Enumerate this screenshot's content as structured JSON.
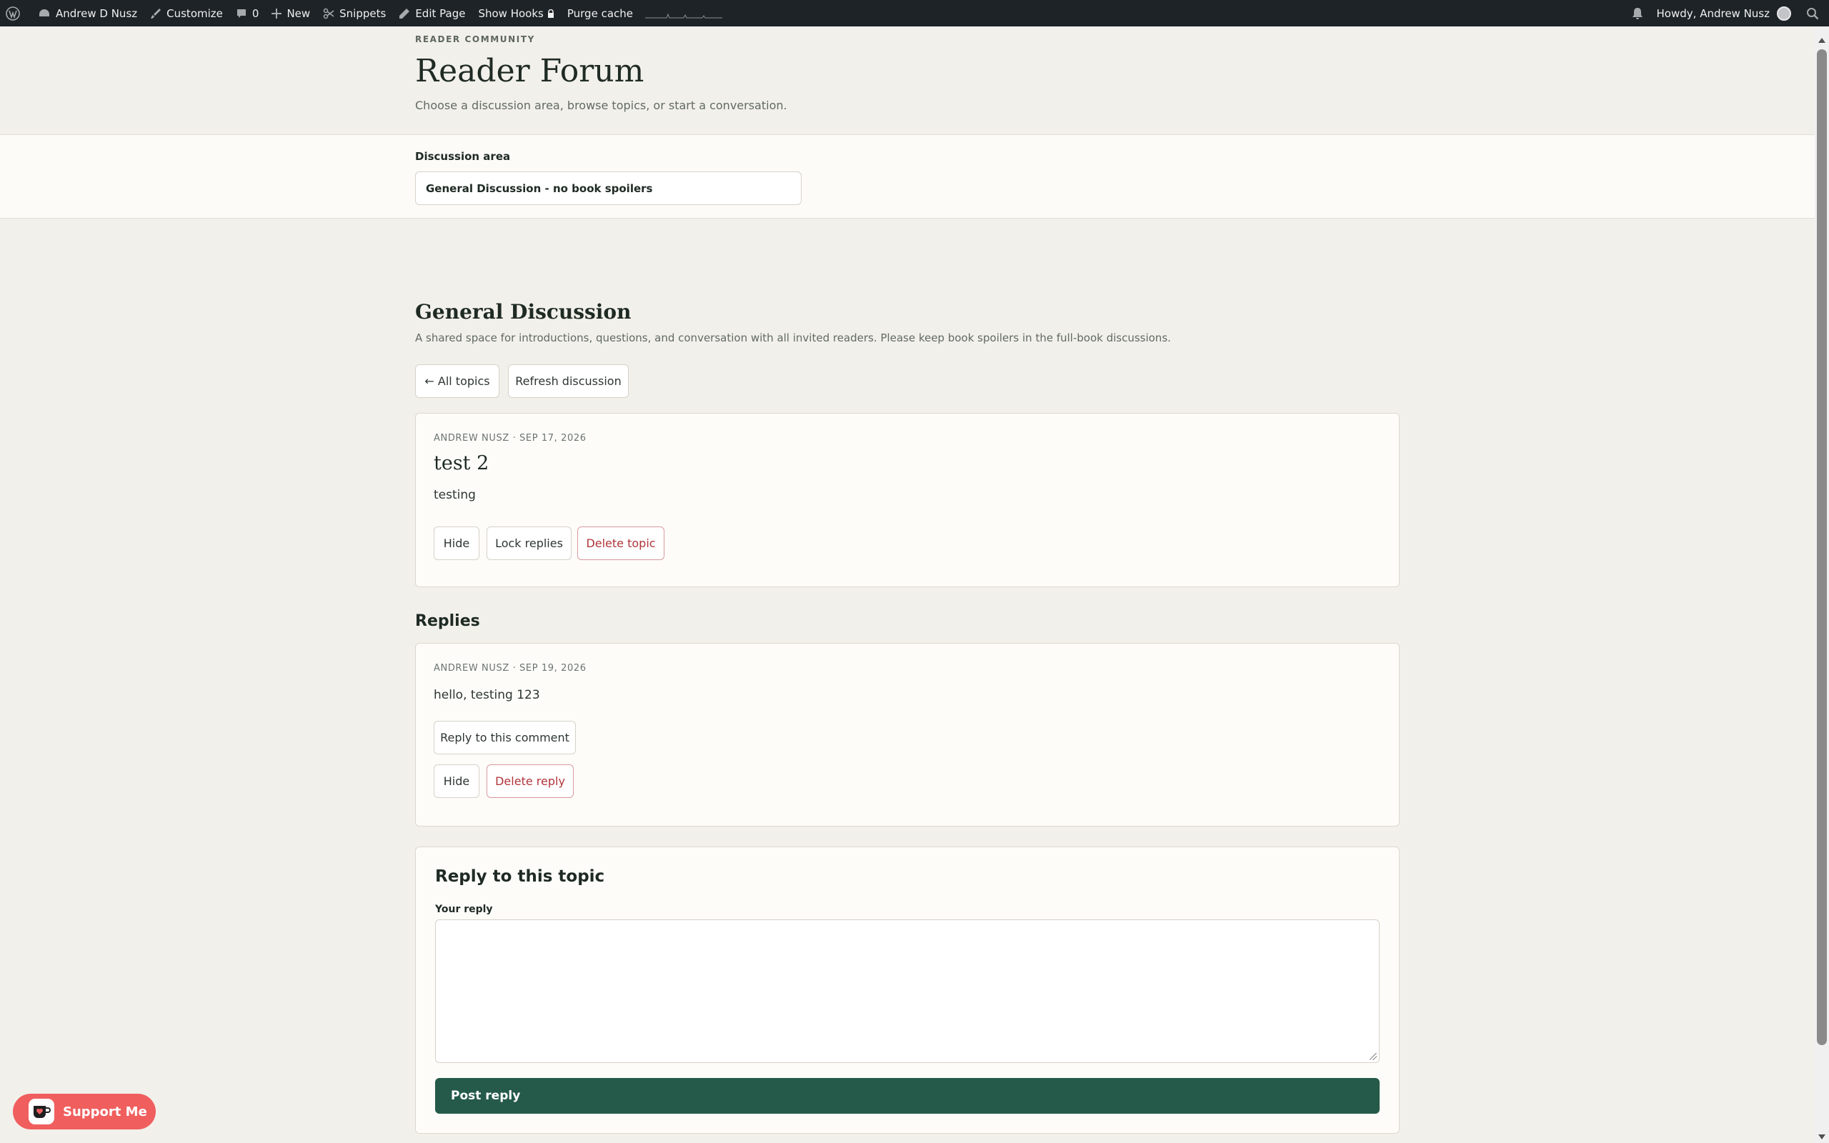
{
  "admin_bar": {
    "site_name": "Andrew D Nusz",
    "customize": "Customize",
    "comments_count": "0",
    "new": "New",
    "snippets": "Snippets",
    "edit_page": "Edit Page",
    "show_hooks": "Show Hooks",
    "purge_cache": "Purge cache",
    "greeting": "Howdy, Andrew Nusz"
  },
  "header": {
    "eyebrow": "READER COMMUNITY",
    "title": "Reader Forum",
    "subtitle": "Choose a discussion area, browse topics, or start a conversation."
  },
  "area_select": {
    "label": "Discussion area",
    "value": "General Discussion - no book spoilers"
  },
  "section": {
    "title": "General Discussion",
    "description": "A shared space for introductions, questions, and conversation with all invited readers. Please keep book spoilers in the full-book discussions.",
    "all_topics": "← All topics",
    "refresh": "Refresh discussion"
  },
  "topic": {
    "meta": "ANDREW NUSZ · SEP 17, 2026",
    "title": "test 2",
    "body": "testing",
    "hide": "Hide",
    "lock": "Lock replies",
    "delete": "Delete topic"
  },
  "replies": {
    "heading": "Replies",
    "items": [
      {
        "meta": "ANDREW NUSZ · SEP 19, 2026",
        "body": "hello, testing 123",
        "reply_to": "Reply to this comment",
        "hide": "Hide",
        "delete": "Delete reply"
      }
    ]
  },
  "reply_form": {
    "heading": "Reply to this topic",
    "label": "Your reply",
    "value": "",
    "submit": "Post reply"
  },
  "support": {
    "label": "Support Me"
  },
  "colors": {
    "accent": "#255a4a",
    "danger": "#b0343a",
    "background": "#f2f0eb",
    "admin_bar": "#1d2327",
    "support": "#f05e5e"
  }
}
